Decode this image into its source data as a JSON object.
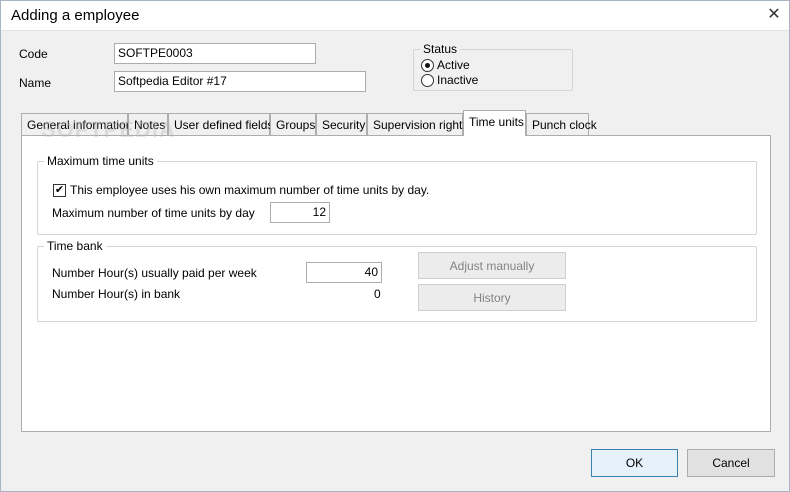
{
  "window": {
    "title": "Adding a employee",
    "close_glyph": "✕"
  },
  "form": {
    "code_label": "Code",
    "code_value": "SOFTPE0003",
    "name_label": "Name",
    "name_value": "Softpedia Editor #17"
  },
  "status": {
    "legend": "Status",
    "options": [
      {
        "label": "Active",
        "selected": true
      },
      {
        "label": "Inactive",
        "selected": false
      }
    ]
  },
  "tabs": [
    {
      "label": "General information",
      "active": false
    },
    {
      "label": "Notes",
      "active": false
    },
    {
      "label": "User defined fields",
      "active": false
    },
    {
      "label": "Groups",
      "active": false
    },
    {
      "label": "Security",
      "active": false
    },
    {
      "label": "Supervision rights",
      "active": false
    },
    {
      "label": "Time units",
      "active": true
    },
    {
      "label": "Punch clock",
      "active": false
    }
  ],
  "max_time_units": {
    "legend": "Maximum time units",
    "checkbox_label": "This employee uses his own maximum number of time units by day.",
    "checkbox_checked": true,
    "check_glyph": "✔",
    "field_label": "Maximum number of time units by day",
    "field_value": "12"
  },
  "time_bank": {
    "legend": "Time bank",
    "paid_label": "Number Hour(s) usually paid per week",
    "paid_value": "40",
    "bank_label": "Number Hour(s) in bank",
    "bank_value": "0",
    "adjust_button": "Adjust manually",
    "history_button": "History"
  },
  "footer": {
    "ok_label": "OK",
    "cancel_label": "Cancel"
  },
  "watermark": "SOFTPEDIA"
}
